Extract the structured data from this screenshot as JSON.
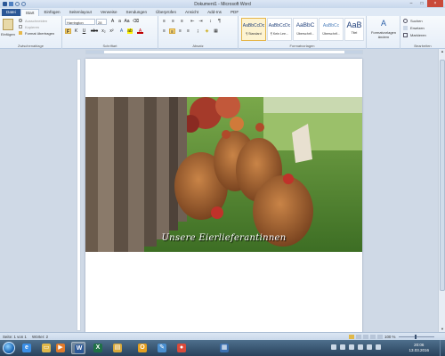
{
  "window": {
    "title": "Dokument1 - Microsoft Word",
    "controls": [
      "–",
      "□",
      "×"
    ]
  },
  "tabs": [
    {
      "label": "Datei"
    },
    {
      "label": "Start"
    },
    {
      "label": "Einfügen"
    },
    {
      "label": "Seitenlayout"
    },
    {
      "label": "Verweise"
    },
    {
      "label": "Sendungen"
    },
    {
      "label": "Überprüfen"
    },
    {
      "label": "Ansicht"
    },
    {
      "label": "Add-Ins"
    },
    {
      "label": "PDF"
    }
  ],
  "ribbon": {
    "clipboard": {
      "paste": "Einfügen",
      "cut": "Ausschneiden",
      "copy": "Kopieren",
      "format_painter": "Format übertragen",
      "label": "Zwischenablage"
    },
    "font": {
      "name": "Harrington",
      "size": "28",
      "bold": "F",
      "italic": "K",
      "underline": "U",
      "strike": "abc",
      "subscript": "x₂",
      "superscript": "x²",
      "label": "Schriftart"
    },
    "paragraph": {
      "label": "Absatz"
    },
    "styles": {
      "items": [
        {
          "sample": "AaBbCcDc",
          "name": "¶ Standard"
        },
        {
          "sample": "AaBbCcDc",
          "name": "¶ Kein Lee..."
        },
        {
          "sample": "AaBbC",
          "name": "Überschrif..."
        },
        {
          "sample": "AaBbCc",
          "name": "Überschrif..."
        },
        {
          "sample": "AaB",
          "name": "Titel"
        }
      ],
      "change_styles": "Formatvorlagen ändern",
      "label": "Formatvorlagen"
    },
    "editing": {
      "find": "Suchen",
      "replace": "Ersetzen",
      "select": "Markieren",
      "label": "Bearbeiten"
    }
  },
  "document": {
    "caption": "Unsere Eierlieferantinnen"
  },
  "statusbar": {
    "page": "Seite: 1 von 1",
    "words": "Wörter: 2",
    "zoom": "100 %"
  },
  "taskbar": {
    "time": "20:06",
    "date": "13.03.2016",
    "apps": [
      {
        "icon": "ie-icon",
        "color": "#3a8ee6",
        "glyph": "e"
      },
      {
        "icon": "folder-icon",
        "color": "#e0b84a",
        "glyph": "▭"
      },
      {
        "icon": "media-player-icon",
        "color": "#e07a2a",
        "glyph": "▶"
      },
      {
        "icon": "word-icon",
        "color": "#2b5797",
        "glyph": "W"
      },
      {
        "icon": "excel-icon",
        "color": "#1e7145",
        "glyph": "X"
      },
      {
        "icon": "explorer-icon",
        "color": "#d9a93a",
        "glyph": "▤"
      },
      {
        "icon": "outlook-icon",
        "color": "#e6a020",
        "glyph": "O"
      },
      {
        "icon": "paint-icon",
        "color": "#4a8fd0",
        "glyph": "✎"
      },
      {
        "icon": "chrome-icon",
        "color": "#d94a3a",
        "glyph": "●"
      },
      {
        "icon": "calendar-icon",
        "color": "#3b6fb0",
        "glyph": "▦"
      }
    ]
  }
}
